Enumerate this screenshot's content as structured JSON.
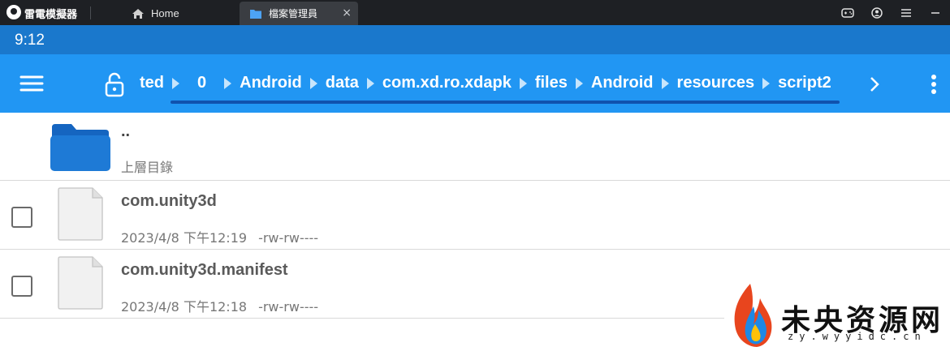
{
  "titlebar": {
    "app_name": "雷電模擬器",
    "tabs": [
      {
        "label": "Home",
        "icon": "home-icon",
        "active": false
      },
      {
        "label": "檔案管理員",
        "icon": "folder-icon",
        "active": true,
        "close": "×"
      }
    ],
    "right_buttons": [
      "gamepad-icon",
      "account-icon",
      "menu-icon",
      "minimize-icon"
    ]
  },
  "statusbar": {
    "time": "9:12"
  },
  "appbar": {
    "color": "#2196f3",
    "breadcrumb": [
      "ted",
      "0",
      "Android",
      "data",
      "com.xd.ro.xdapk",
      "files",
      "Android",
      "resources",
      "script2"
    ]
  },
  "files": {
    "parent": {
      "name": "..",
      "label": "上層目錄"
    },
    "items": [
      {
        "name": "com.unity3d",
        "date": "2023/4/8 下午12:19",
        "perms": "-rw-rw----"
      },
      {
        "name": "com.unity3d.manifest",
        "date": "2023/4/8 下午12:18",
        "perms": "-rw-rw----"
      }
    ]
  },
  "watermark": {
    "title": "未央资源网",
    "url": "zy.wyyidc.cn"
  }
}
